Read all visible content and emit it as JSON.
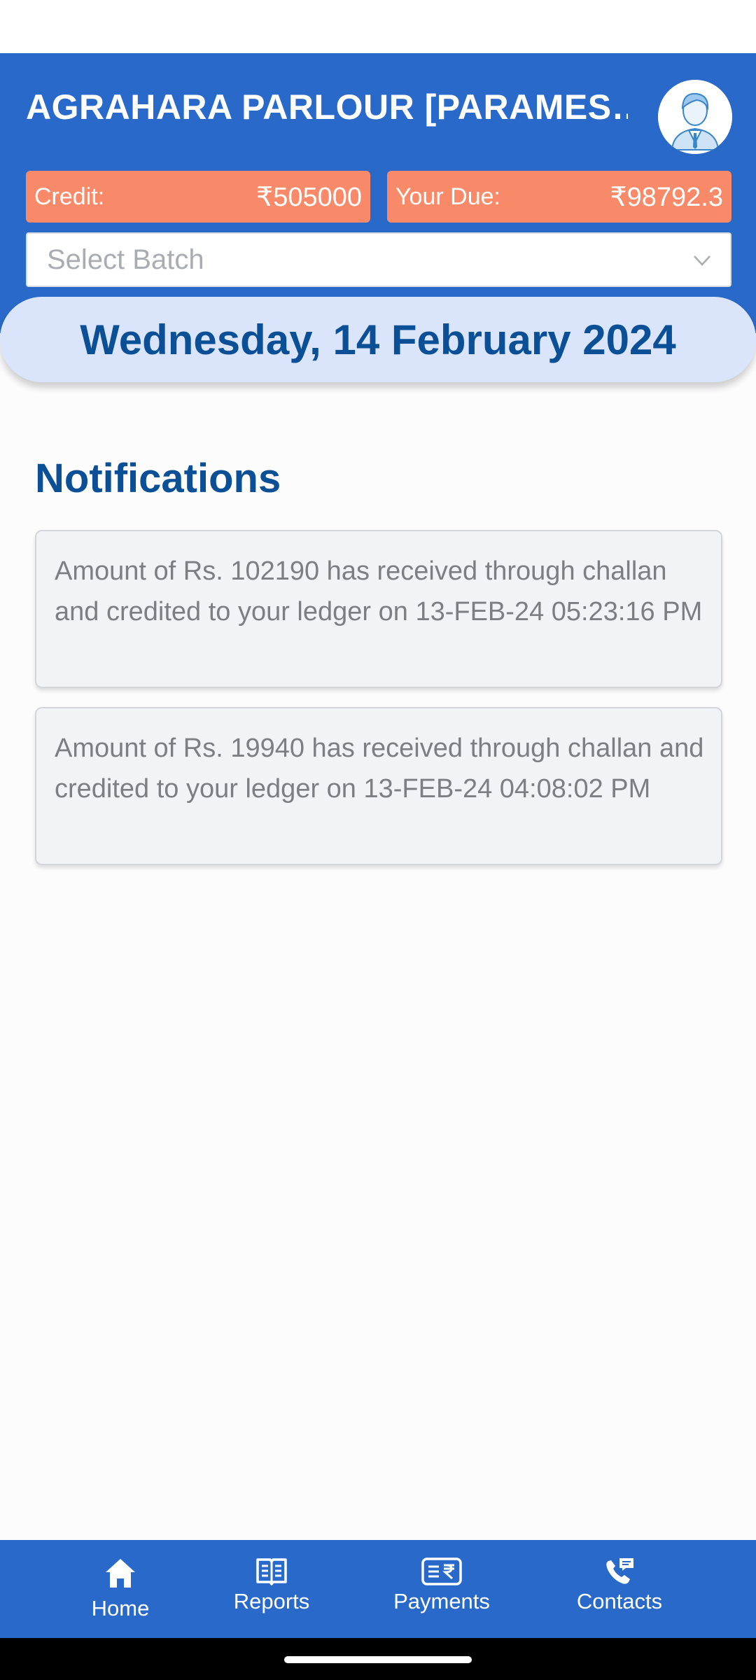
{
  "header": {
    "title": "AGRAHARA PARLOUR [PARAMES…",
    "credit_label": "Credit:",
    "credit_value": "₹505000",
    "due_label": "Your Due:",
    "due_value": "₹98792.3",
    "batch_placeholder": "Select Batch"
  },
  "date_banner": "Wednesday, 14 February 2024",
  "notifications": {
    "title": "Notifications",
    "items": [
      "Amount of Rs. 102190 has received through challan and credited to your ledger on 13-FEB-24 05:23:16 PM",
      "Amount of Rs. 19940 has received through challan and credited to your ledger on 13-FEB-24 04:08:02 PM"
    ]
  },
  "bottom_nav": {
    "items": [
      {
        "label": "Home",
        "icon": "home-icon"
      },
      {
        "label": "Reports",
        "icon": "book-icon"
      },
      {
        "label": "Payments",
        "icon": "payments-icon"
      },
      {
        "label": "Contacts",
        "icon": "phone-chat-icon"
      }
    ],
    "active": "Home"
  },
  "colors": {
    "primary": "#2969c9",
    "accent": "#f98a69",
    "heading": "#0b4f96",
    "date_banner_bg": "#dae5fb"
  }
}
